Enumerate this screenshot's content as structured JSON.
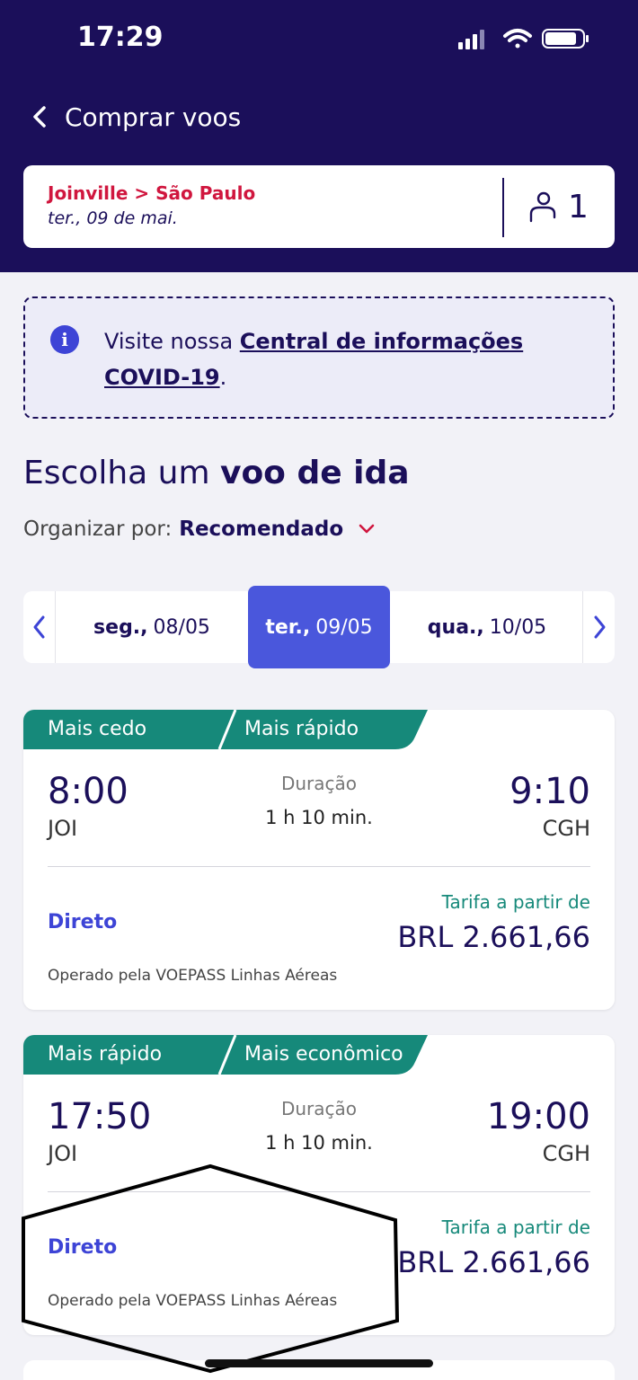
{
  "status_bar": {
    "time": "17:29"
  },
  "nav": {
    "back_label": "Comprar voos"
  },
  "search": {
    "route": "Joinville > São Paulo",
    "date": "ter., 09 de mai.",
    "passengers": "1"
  },
  "covid": {
    "text_prefix": "Visite nossa ",
    "link_text": "Central de informações COVID-19",
    "text_suffix": "."
  },
  "heading": {
    "prefix": "Escolha um ",
    "emphasis": "voo de ida"
  },
  "sort": {
    "label": "Organizar por:",
    "value": "Recomendado"
  },
  "dates": [
    {
      "day": "seg.,",
      "date": "08/05",
      "active": false
    },
    {
      "day": "ter.,",
      "date": "09/05",
      "active": true
    },
    {
      "day": "qua.,",
      "date": "10/05",
      "active": false
    }
  ],
  "flights": [
    {
      "badges": [
        "Mais cedo",
        "Mais rápido"
      ],
      "departure_time": "8:00",
      "departure_code": "JOI",
      "duration_label": "Duração",
      "duration": "1 h 10 min.",
      "arrival_time": "9:10",
      "arrival_code": "CGH",
      "stops": "Direto",
      "fare_label": "Tarifa a partir de",
      "fare": "BRL 2.661,66",
      "operator": "Operado pela VOEPASS Linhas Aéreas"
    },
    {
      "badges": [
        "Mais rápido",
        "Mais econômico"
      ],
      "departure_time": "17:50",
      "departure_code": "JOI",
      "duration_label": "Duração",
      "duration": "1 h 10 min.",
      "arrival_time": "19:00",
      "arrival_code": "CGH",
      "stops": "Direto",
      "fare_label": "Tarifa a partir de",
      "fare": "BRL 2.661,66",
      "operator": "Operado pela VOEPASS Linhas Aéreas"
    }
  ],
  "colors": {
    "header": "#1b0f5a",
    "accent": "#4a57dc",
    "badge": "#16897a",
    "route": "#d0163e"
  }
}
